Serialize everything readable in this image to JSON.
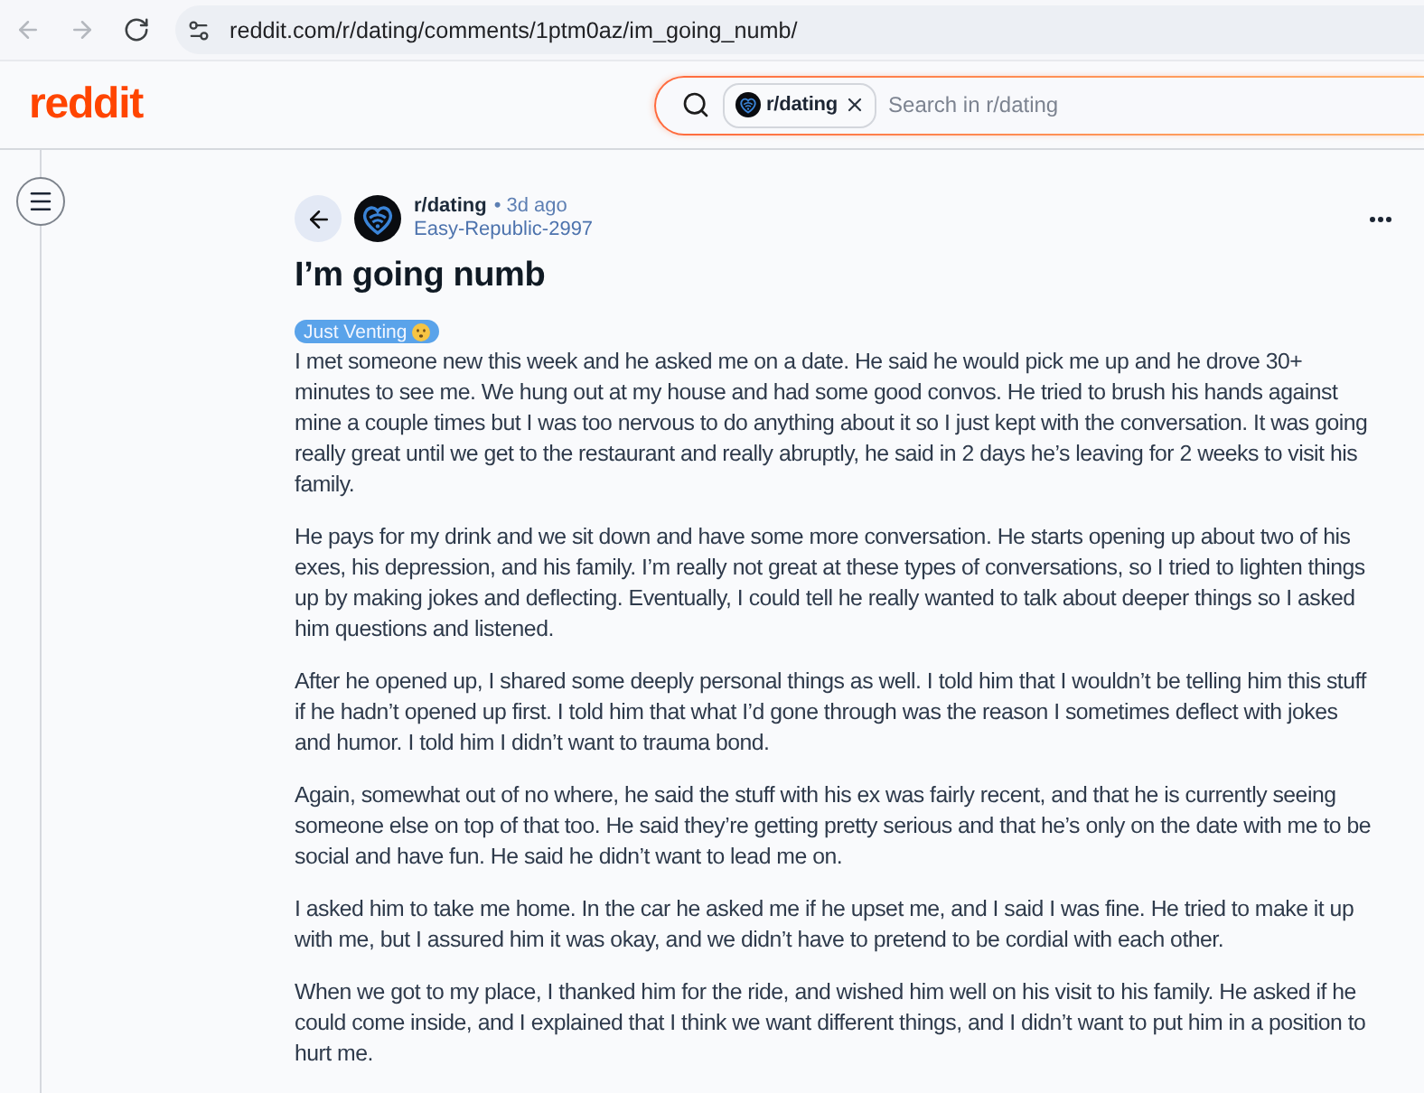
{
  "browser": {
    "nav_buttons": [
      {
        "kind": "back",
        "disabled": true
      },
      {
        "kind": "forward",
        "disabled": true
      },
      {
        "kind": "reload",
        "disabled": false
      }
    ],
    "url": "reddit.com/r/dating/comments/1ptm0az/im_going_numb/"
  },
  "header": {
    "logo": "reddit",
    "search": {
      "scope_chip": "r/dating",
      "placeholder": "Search in r/dating"
    }
  },
  "post": {
    "subreddit": "r/dating",
    "time": "• 3d ago",
    "author": "Easy-Republic-2997",
    "title": "I’m going numb",
    "flair": "Just Venting",
    "body": [
      "I met someone new this week and he asked me on a date. He said he would pick me up and he drove 30+ minutes to see me. We hung out at my house and had some good convos. He tried to brush his hands against mine a couple times but I was too nervous to do anything about it so I just kept with the conversation. It was going really great until we get to the restaurant and really abruptly, he said in 2 days he’s leaving for 2 weeks to visit his family.",
      "He pays for my drink and we sit down and have some more conversation. He starts opening up about two of his exes, his depression, and his family. I’m really not great at these types of conversations, so I tried to lighten things up by making jokes and deflecting. Eventually, I could tell he really wanted to talk about deeper things so I asked him questions and listened.",
      "After he opened up, I shared some deeply personal things as well. I told him that I wouldn’t be telling him this stuff if he hadn’t opened up first. I told him that what I’d gone through was the reason I sometimes deflect with jokes and humor. I told him I didn’t want to trauma bond.",
      "Again, somewhat out of no where, he said the stuff with his ex was fairly recent, and that he is currently seeing someone else on top of that too. He said they’re getting pretty serious and that he’s only on the date with me to be social and have fun. He said he didn’t want to lead me on.",
      "I asked him to take me home. In the car he asked me if he upset me, and I said I was fine. He tried to make it up with me, but I assured him it was okay, and we didn’t have to pretend to be cordial with each other.",
      "When we got to my place, I thanked him for the ride, and wished him well on his visit to his family. He asked if he could come inside, and I explained that I think we want different things, and I didn’t want to put him in a position to hurt me."
    ]
  }
}
